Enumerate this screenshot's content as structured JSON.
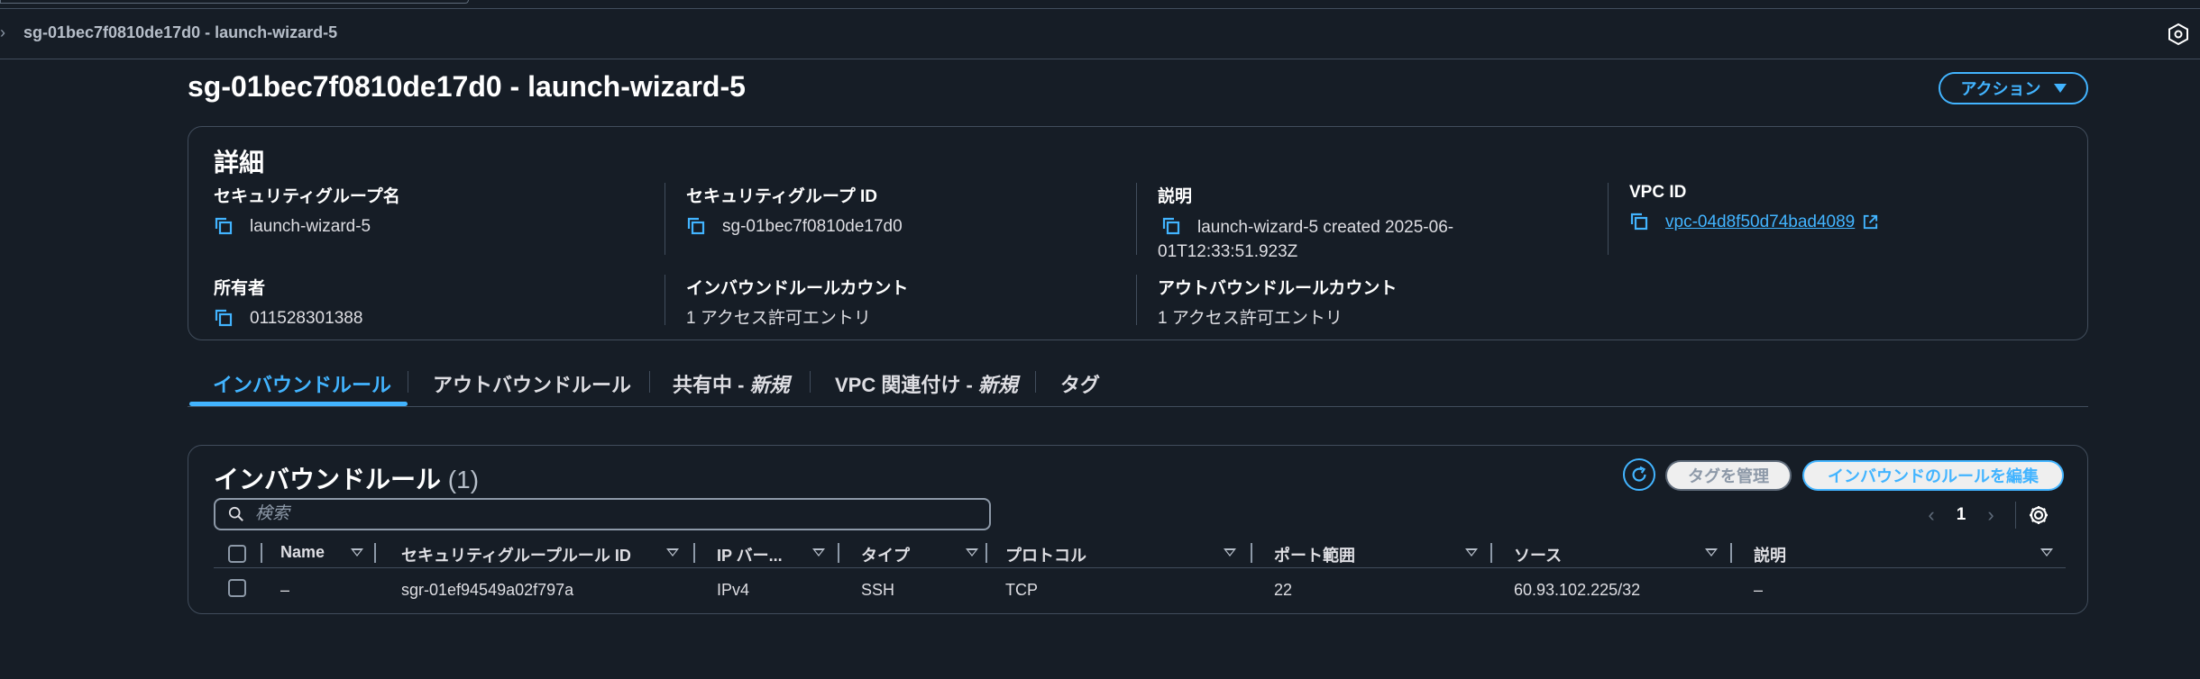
{
  "breadcrumb": {
    "text": "sg-01bec7f0810de17d0 - launch-wizard-5"
  },
  "page": {
    "title": "sg-01bec7f0810de17d0 - launch-wizard-5",
    "actions_label": "アクション"
  },
  "details": {
    "heading": "詳細",
    "sg_name": {
      "label": "セキュリティグループ名",
      "value": "launch-wizard-5"
    },
    "sg_id": {
      "label": "セキュリティグループ ID",
      "value": "sg-01bec7f0810de17d0"
    },
    "description": {
      "label": "説明",
      "value_line1": "launch-wizard-5 created 2025-06-",
      "value_line2": "01T12:33:51.923Z"
    },
    "vpc": {
      "label": "VPC ID",
      "value": "vpc-04d8f50d74bad4089"
    },
    "owner": {
      "label": "所有者",
      "value": "011528301388"
    },
    "inbound_count": {
      "label": "インバウンドルールカウント",
      "value": "1 アクセス許可エントリ"
    },
    "outbound_count": {
      "label": "アウトバウンドルールカウント",
      "value": "1 アクセス許可エントリ"
    }
  },
  "tabs": [
    {
      "label": "インバウンドルール"
    },
    {
      "label": "アウトバウンドルール"
    },
    {
      "label": "共有中 - ",
      "suffix": "新規"
    },
    {
      "label": "VPC 関連付け - ",
      "suffix": "新規"
    },
    {
      "label": "タグ"
    }
  ],
  "rules": {
    "heading": "インバウンドルール",
    "count": "(1)",
    "manage_tags_label": "タグを管理",
    "edit_label": "インバウンドのルールを編集",
    "search_placeholder": "検索",
    "page_number": "1",
    "columns": [
      "Name",
      "セキュリティグループルール ID",
      "IP バー...",
      "タイプ",
      "プロトコル",
      "ポート範囲",
      "ソース",
      "説明"
    ],
    "rows": [
      {
        "name": "–",
        "rule_id": "sgr-01ef94549a02f797a",
        "ip_version": "IPv4",
        "type": "SSH",
        "protocol": "TCP",
        "port": "22",
        "source": "60.93.102.225/32",
        "description": "–"
      }
    ]
  },
  "colors": {
    "accent": "#42b4ff",
    "background": "#161d26",
    "border": "#414d5c"
  }
}
